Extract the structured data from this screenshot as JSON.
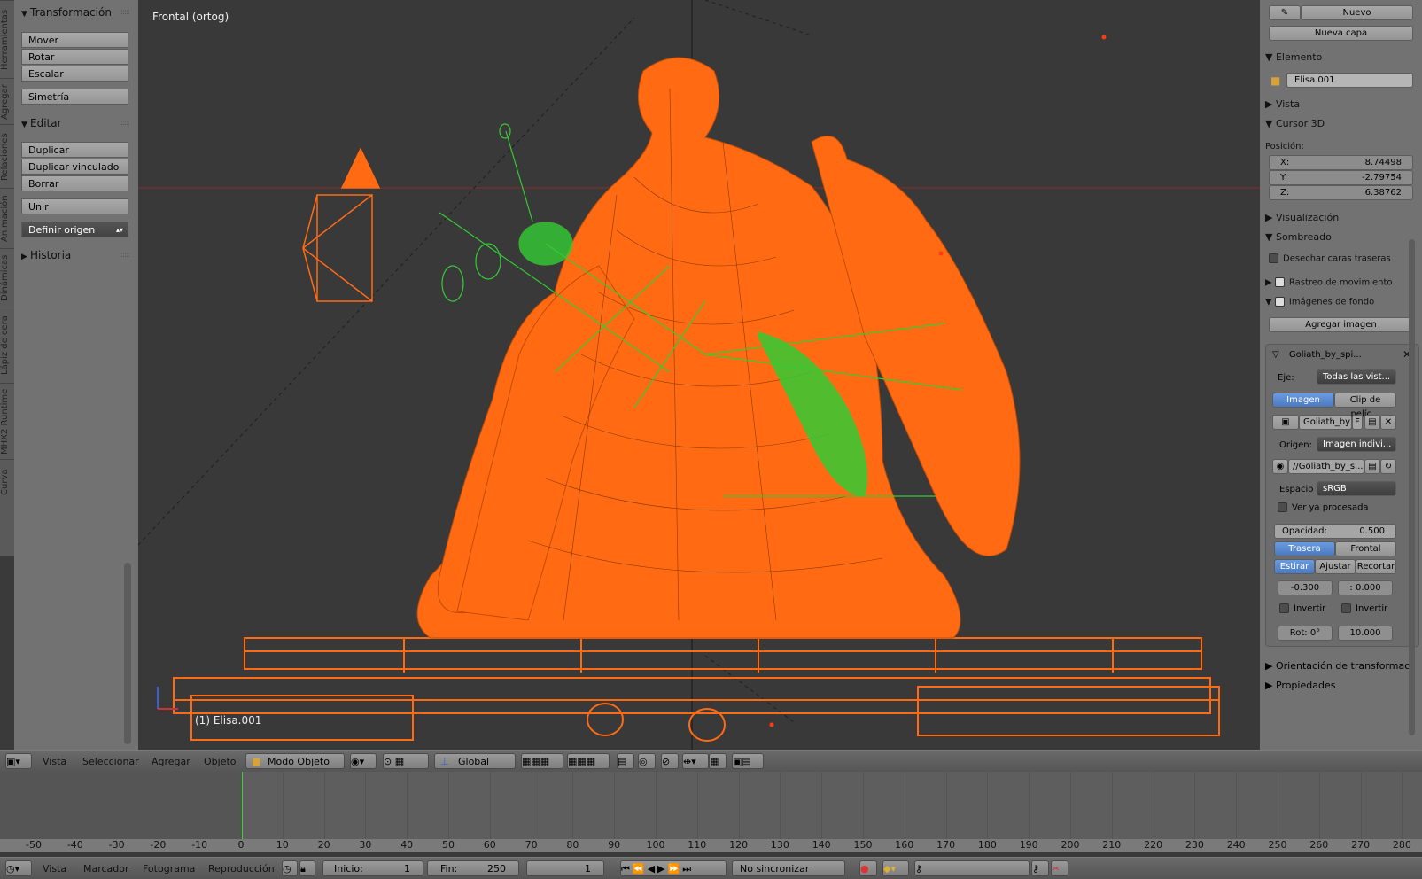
{
  "viewport": {
    "title": "Frontal (ortog)",
    "object_label": "(1) Elisa.001"
  },
  "left_tabs": [
    "Herramientas",
    "Agregar",
    "Relaciones",
    "Animación",
    "Dinámicas",
    "Lápiz de cera",
    "MHX2 Runtime",
    "Curva"
  ],
  "toolshelf": {
    "transform_title": "Transformación",
    "transform_buttons": [
      "Mover",
      "Rotar",
      "Escalar"
    ],
    "mirror": "Simetría",
    "edit_title": "Editar",
    "edit_buttons": [
      "Duplicar",
      "Duplicar vinculado",
      "Borrar"
    ],
    "join": "Unir",
    "origin": "Definir origen",
    "history_title": "Historia"
  },
  "properties": {
    "new": "Nuevo",
    "new_layer": "Nueva capa",
    "element_title": "Elemento",
    "element_name": "Elisa.001",
    "view_title": "Vista",
    "cursor_title": "Cursor 3D",
    "position_label": "Posición:",
    "x_label": "X:",
    "x_value": "8.74498",
    "y_label": "Y:",
    "y_value": "-2.79754",
    "z_label": "Z:",
    "z_value": "6.38762",
    "display_title": "Visualización",
    "shading_title": "Sombreado",
    "backface": "Desechar caras traseras",
    "motion_tracking": "Rastreo de movimiento",
    "bg_images": "Imágenes de fondo",
    "add_image": "Agregar imagen",
    "bg_name": "Goliath_by_spi...",
    "axis_label": "Eje:",
    "axis_value": "Todas las vist...",
    "image_tab": "Imagen",
    "clip_tab": "Clip de pelíc...",
    "image_name": "Goliath_by",
    "image_flag": "F",
    "source_label": "Origen:",
    "source_value": "Imagen indivi...",
    "filepath": "//Goliath_by_s...",
    "space_label": "Espacio",
    "space_value": "sRGB",
    "view_processed": "Ver ya procesada",
    "opacity_label": "Opacidad:",
    "opacity_value": "0.500",
    "back": "Trasera",
    "front": "Frontal",
    "stretch": "Estirar",
    "fit": "Ajustar",
    "crop": "Recortar",
    "offset_x": "-0.300",
    "offset_y": ": 0.000",
    "invert1": "Invertir",
    "invert2": "Invertir",
    "rot": "Rot: 0°",
    "size": "10.000",
    "transform_orient": "Orientación de transformaci",
    "props_title": "Propiedades"
  },
  "view_header": {
    "menus": [
      "Vista",
      "Seleccionar",
      "Agregar",
      "Objeto"
    ],
    "mode": "Modo Objeto",
    "orientation": "Global"
  },
  "timeline": {
    "ticks": [
      -50,
      -40,
      -30,
      -20,
      -10,
      0,
      10,
      20,
      30,
      40,
      50,
      60,
      70,
      80,
      90,
      100,
      110,
      120,
      130,
      140,
      150,
      160,
      170,
      180,
      190,
      200,
      210,
      220,
      230,
      240,
      250,
      260,
      270,
      280
    ],
    "current_frame_pos": 1
  },
  "timeline_header": {
    "menus": [
      "Vista",
      "Marcador",
      "Fotograma",
      "Reproducción"
    ],
    "start_label": "Inicio:",
    "start_value": "1",
    "end_label": "Fin:",
    "end_value": "250",
    "current": "1",
    "sync": "No sincronizar"
  },
  "colors": {
    "mesh": "#ff6a13",
    "rig": "#33cc33",
    "accent_blue": "#5a8ad6"
  }
}
